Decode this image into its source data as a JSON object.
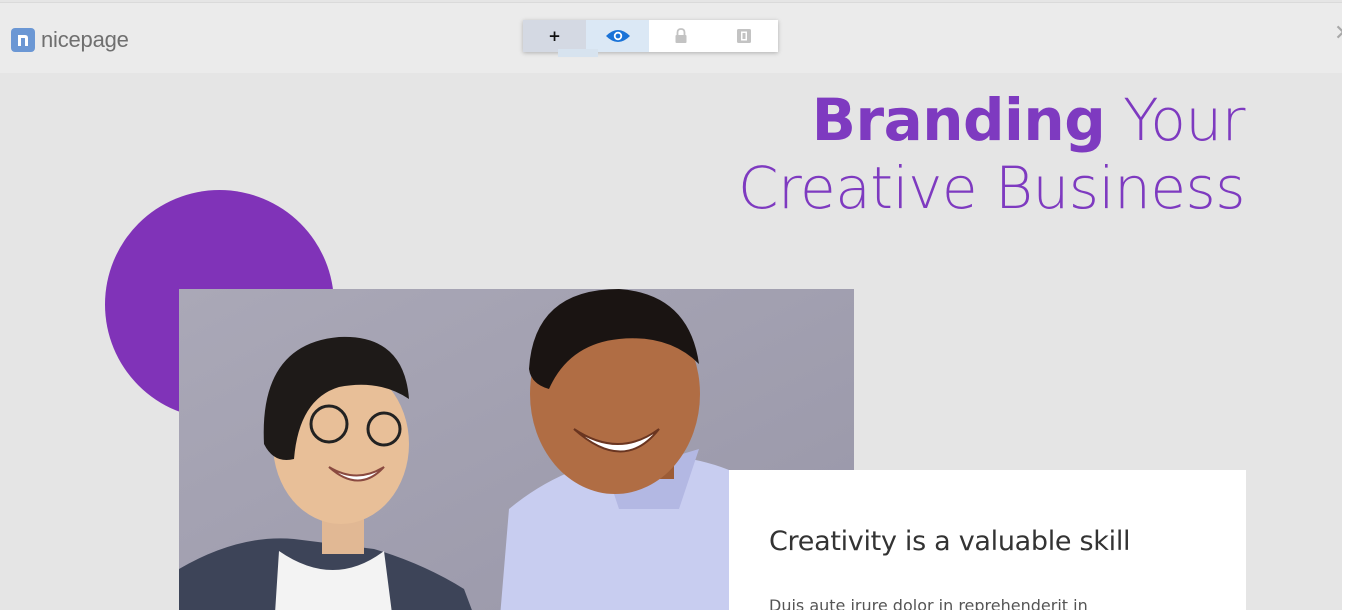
{
  "app": {
    "logo_text": "nicepage"
  },
  "toolbar": {
    "add_label": "+",
    "buttons": [
      "add",
      "preview",
      "lock",
      "responsive"
    ]
  },
  "hero": {
    "headline_bold": "Branding",
    "headline_rest": " Your",
    "headline_line2": "Creative Business",
    "card_title": "Creativity is a valuable skill",
    "card_body": "Duis aute irure dolor in reprehenderit in"
  },
  "colors": {
    "accent": "#7e3ac0",
    "circle": "#8033b8",
    "page_bg": "#e5e5e5",
    "logo_blue": "#6b97d4",
    "preview_blue": "#1a73d8"
  },
  "icons": {
    "logo": "nicepage-logo-icon",
    "close": "close-icon",
    "preview": "eye-icon",
    "lock": "lock-icon",
    "responsive": "device-icon"
  }
}
